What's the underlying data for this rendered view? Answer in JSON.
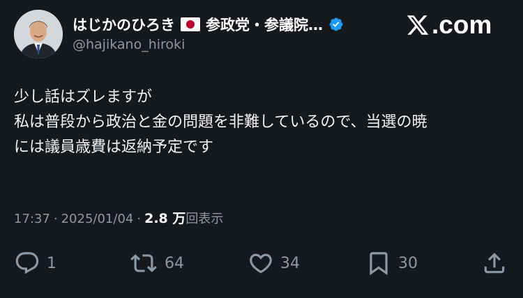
{
  "author": {
    "display_name": "はじかのひろき",
    "name_suffix": "参政党・参議院…",
    "handle": "@hajikano_hiroki",
    "flag": "japan-flag-icon",
    "verified_icon": "verified-badge-icon",
    "verified_color": "#1d9bf0"
  },
  "brand": {
    "logo_icon": "x-logo-icon",
    "domain": ".com"
  },
  "tweet": {
    "lines": [
      "少し話はズレますが",
      "私は普段から政治と金の問題を非難しているので、当選の暁",
      "には議員歳費は返納予定です"
    ]
  },
  "meta": {
    "time": "17:37",
    "separator": "·",
    "date": "2025/01/04",
    "views_count": "2.8 万",
    "views_label": "回表示"
  },
  "actions": {
    "reply": {
      "icon": "reply-icon",
      "count": "1"
    },
    "retweet": {
      "icon": "retweet-icon",
      "count": "64"
    },
    "like": {
      "icon": "heart-icon",
      "count": "34"
    },
    "bookmark": {
      "icon": "bookmark-icon",
      "count": "30"
    },
    "share": {
      "icon": "share-icon"
    }
  },
  "colors": {
    "background": "#15181d",
    "text": "#e7e9ea",
    "secondary": "#8b98a5"
  }
}
